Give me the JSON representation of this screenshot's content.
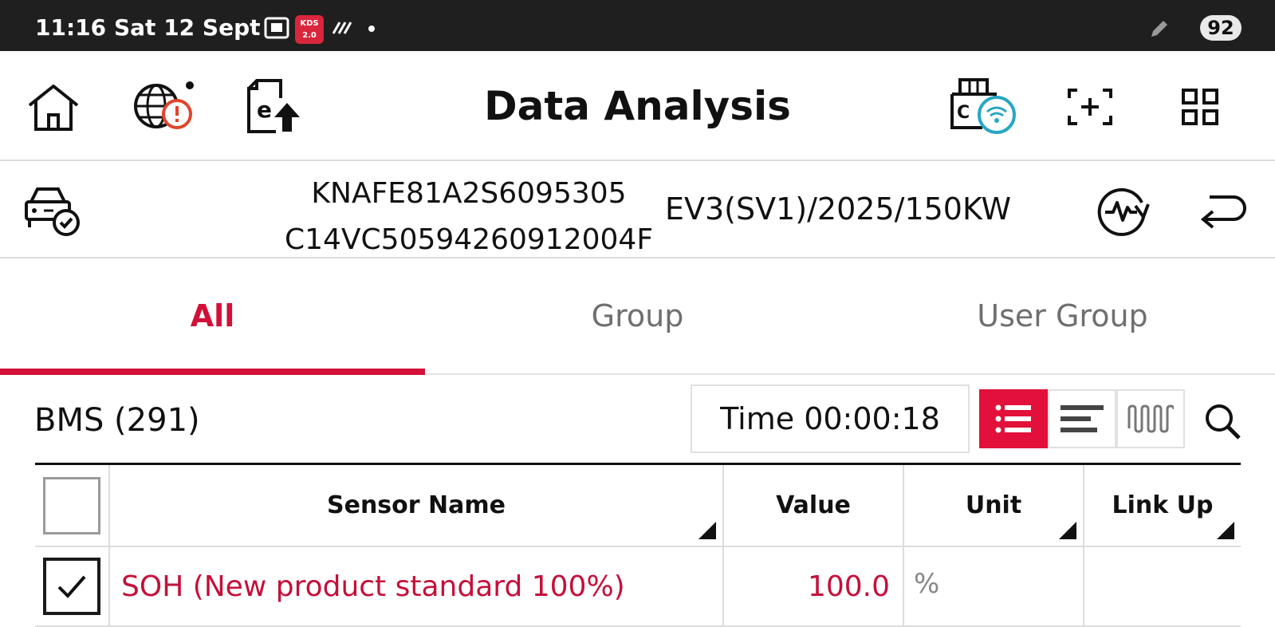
{
  "status_bar": {
    "time": "11:16",
    "date": "Sat 12 Sept",
    "app_badge": "KDS 2.0",
    "battery": "92"
  },
  "app_bar": {
    "title": "Data Analysis",
    "icons": [
      "home-icon",
      "globe-alert-icon",
      "e-upload-icon",
      "vci-wifi-icon",
      "screenshot-icon",
      "grid-menu-icon"
    ]
  },
  "vehicle": {
    "vin": "KNAFE81A2S6095305",
    "vci_id": "C14VC50594260912004F",
    "model": "EV3(SV1)/2025/150KW"
  },
  "tabs": [
    {
      "label": "All",
      "active": true
    },
    {
      "label": "Group",
      "active": false
    },
    {
      "label": "User Group",
      "active": false
    }
  ],
  "toolbar": {
    "group_label": "BMS (291)",
    "time_label": "Time 00:00:18",
    "view_modes": [
      "list-view-icon",
      "bar-view-icon",
      "wave-view-icon"
    ],
    "active_view": "list-view-icon"
  },
  "table": {
    "columns": [
      "Sensor Name",
      "Value",
      "Unit",
      "Link Up"
    ],
    "rows": [
      {
        "checked": true,
        "name": "SOH (New product standard 100%)",
        "value": "100.0",
        "unit": "%",
        "link_up": ""
      }
    ]
  },
  "colors": {
    "accent": "#d31038",
    "status_bar": "#1f1f1f",
    "divider": "#dcdcdc"
  }
}
